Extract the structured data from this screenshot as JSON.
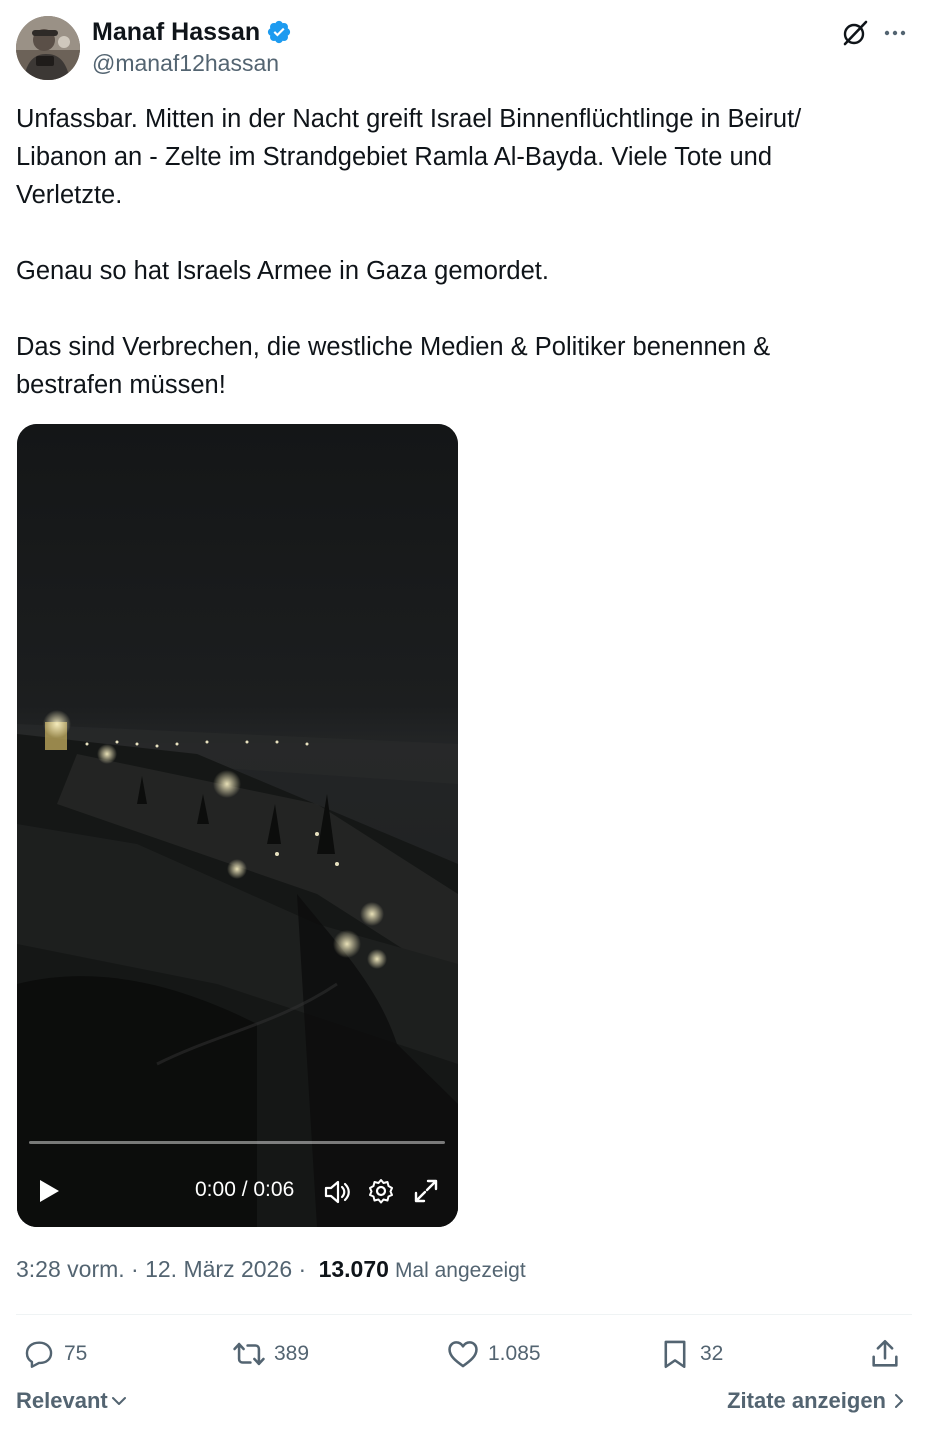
{
  "author": {
    "display_name": "Manaf Hassan",
    "handle": "@manaf12hassan",
    "verified": true,
    "verified_color": "#1d9bf0"
  },
  "tweet": {
    "text": "Unfassbar. Mitten in der Nacht greift Israel Binnenflüchtlinge in Beirut/\nLibanon an - Zelte im Strandgebiet Ramla Al-Bayda. Viele Tote und\nVerletzte.\n\nGenau so hat Israels Armee in Gaza gemordet.\n\nDas sind Verbrechen, die westliche Medien & Politiker benennen &\nbestrafen müssen!"
  },
  "video": {
    "time": "0:00 / 0:06",
    "progress": 0
  },
  "meta": {
    "timestamp": "3:28 vorm. · 12. März 2026 · ",
    "views": "13.070",
    "views_label": "Mal angezeigt"
  },
  "actions": {
    "replies": "75",
    "reposts": "389",
    "likes": "1.085",
    "bookmarks": "32"
  },
  "footer": {
    "sort_label": "Relevant",
    "quotes_label": "Zitate anzeigen"
  },
  "icons": {
    "header": [
      "grok-icon",
      "more-icon"
    ],
    "video_controls": [
      "play-icon",
      "volume-icon",
      "settings-icon",
      "fullscreen-icon"
    ],
    "actions": [
      "reply-icon",
      "repost-icon",
      "like-icon",
      "bookmark-icon",
      "share-icon"
    ]
  },
  "colors": {
    "text_primary": "#0f1419",
    "text_secondary": "#536471",
    "divider": "#eff3f4"
  }
}
